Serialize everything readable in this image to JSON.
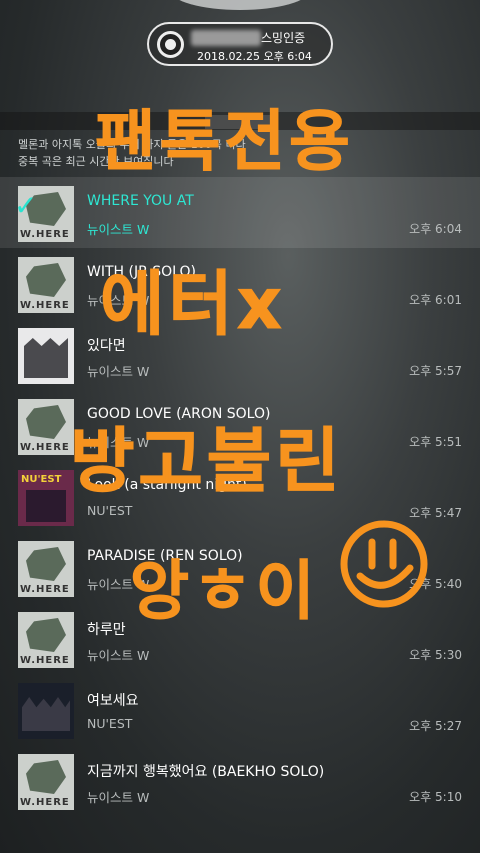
{
  "badge": {
    "title": "스밍인증",
    "date": "2018.02.25 오후 6:04"
  },
  "notice": {
    "line1": "멜론과 아지톡 오늘의 부터 까지 들은 100곡 니다",
    "line2": "중복 곡은 최근 시간만 보여집니다"
  },
  "songs": [
    {
      "title": "WHERE YOU AT",
      "artist": "뉴이스트 W",
      "time": "오후 6:04",
      "art": "w",
      "selected": true
    },
    {
      "title": "WITH (JR SOLO)",
      "artist": "뉴이스트 W",
      "time": "오후 6:01",
      "art": "w"
    },
    {
      "title": "있다면",
      "artist": "뉴이스트 W",
      "time": "오후 5:57",
      "art": "band"
    },
    {
      "title": "GOOD LOVE (ARON SOLO)",
      "artist": "뉴이스트 W",
      "time": "오후 5:51",
      "art": "w"
    },
    {
      "title": "Look (a starlight night)",
      "artist": "NU'EST",
      "time": "오후 5:47",
      "art": "nuest"
    },
    {
      "title": "PARADISE (REN SOLO)",
      "artist": "뉴이스트 W",
      "time": "오후 5:40",
      "art": "w"
    },
    {
      "title": "하루만",
      "artist": "뉴이스트 W",
      "time": "오후 5:30",
      "art": "w"
    },
    {
      "title": "여보세요",
      "artist": "NU'EST",
      "time": "오후 5:27",
      "art": "dark"
    },
    {
      "title": "지금까지 행복했어요 (BAEKHO SOLO)",
      "artist": "뉴이스트 W",
      "time": "오후 5:10",
      "art": "w"
    }
  ],
  "overlay": {
    "line1": "팬톡전용",
    "line2": "에터x",
    "line3": "방고불린",
    "line4": "앙ㅎ이"
  },
  "colors": {
    "accent": "#2ee6d2",
    "graffiti": "#f7931e"
  },
  "icons": {
    "disc": "vinyl-disc-icon",
    "check": "checkmark-icon",
    "smiley": "smiley-face-icon"
  }
}
